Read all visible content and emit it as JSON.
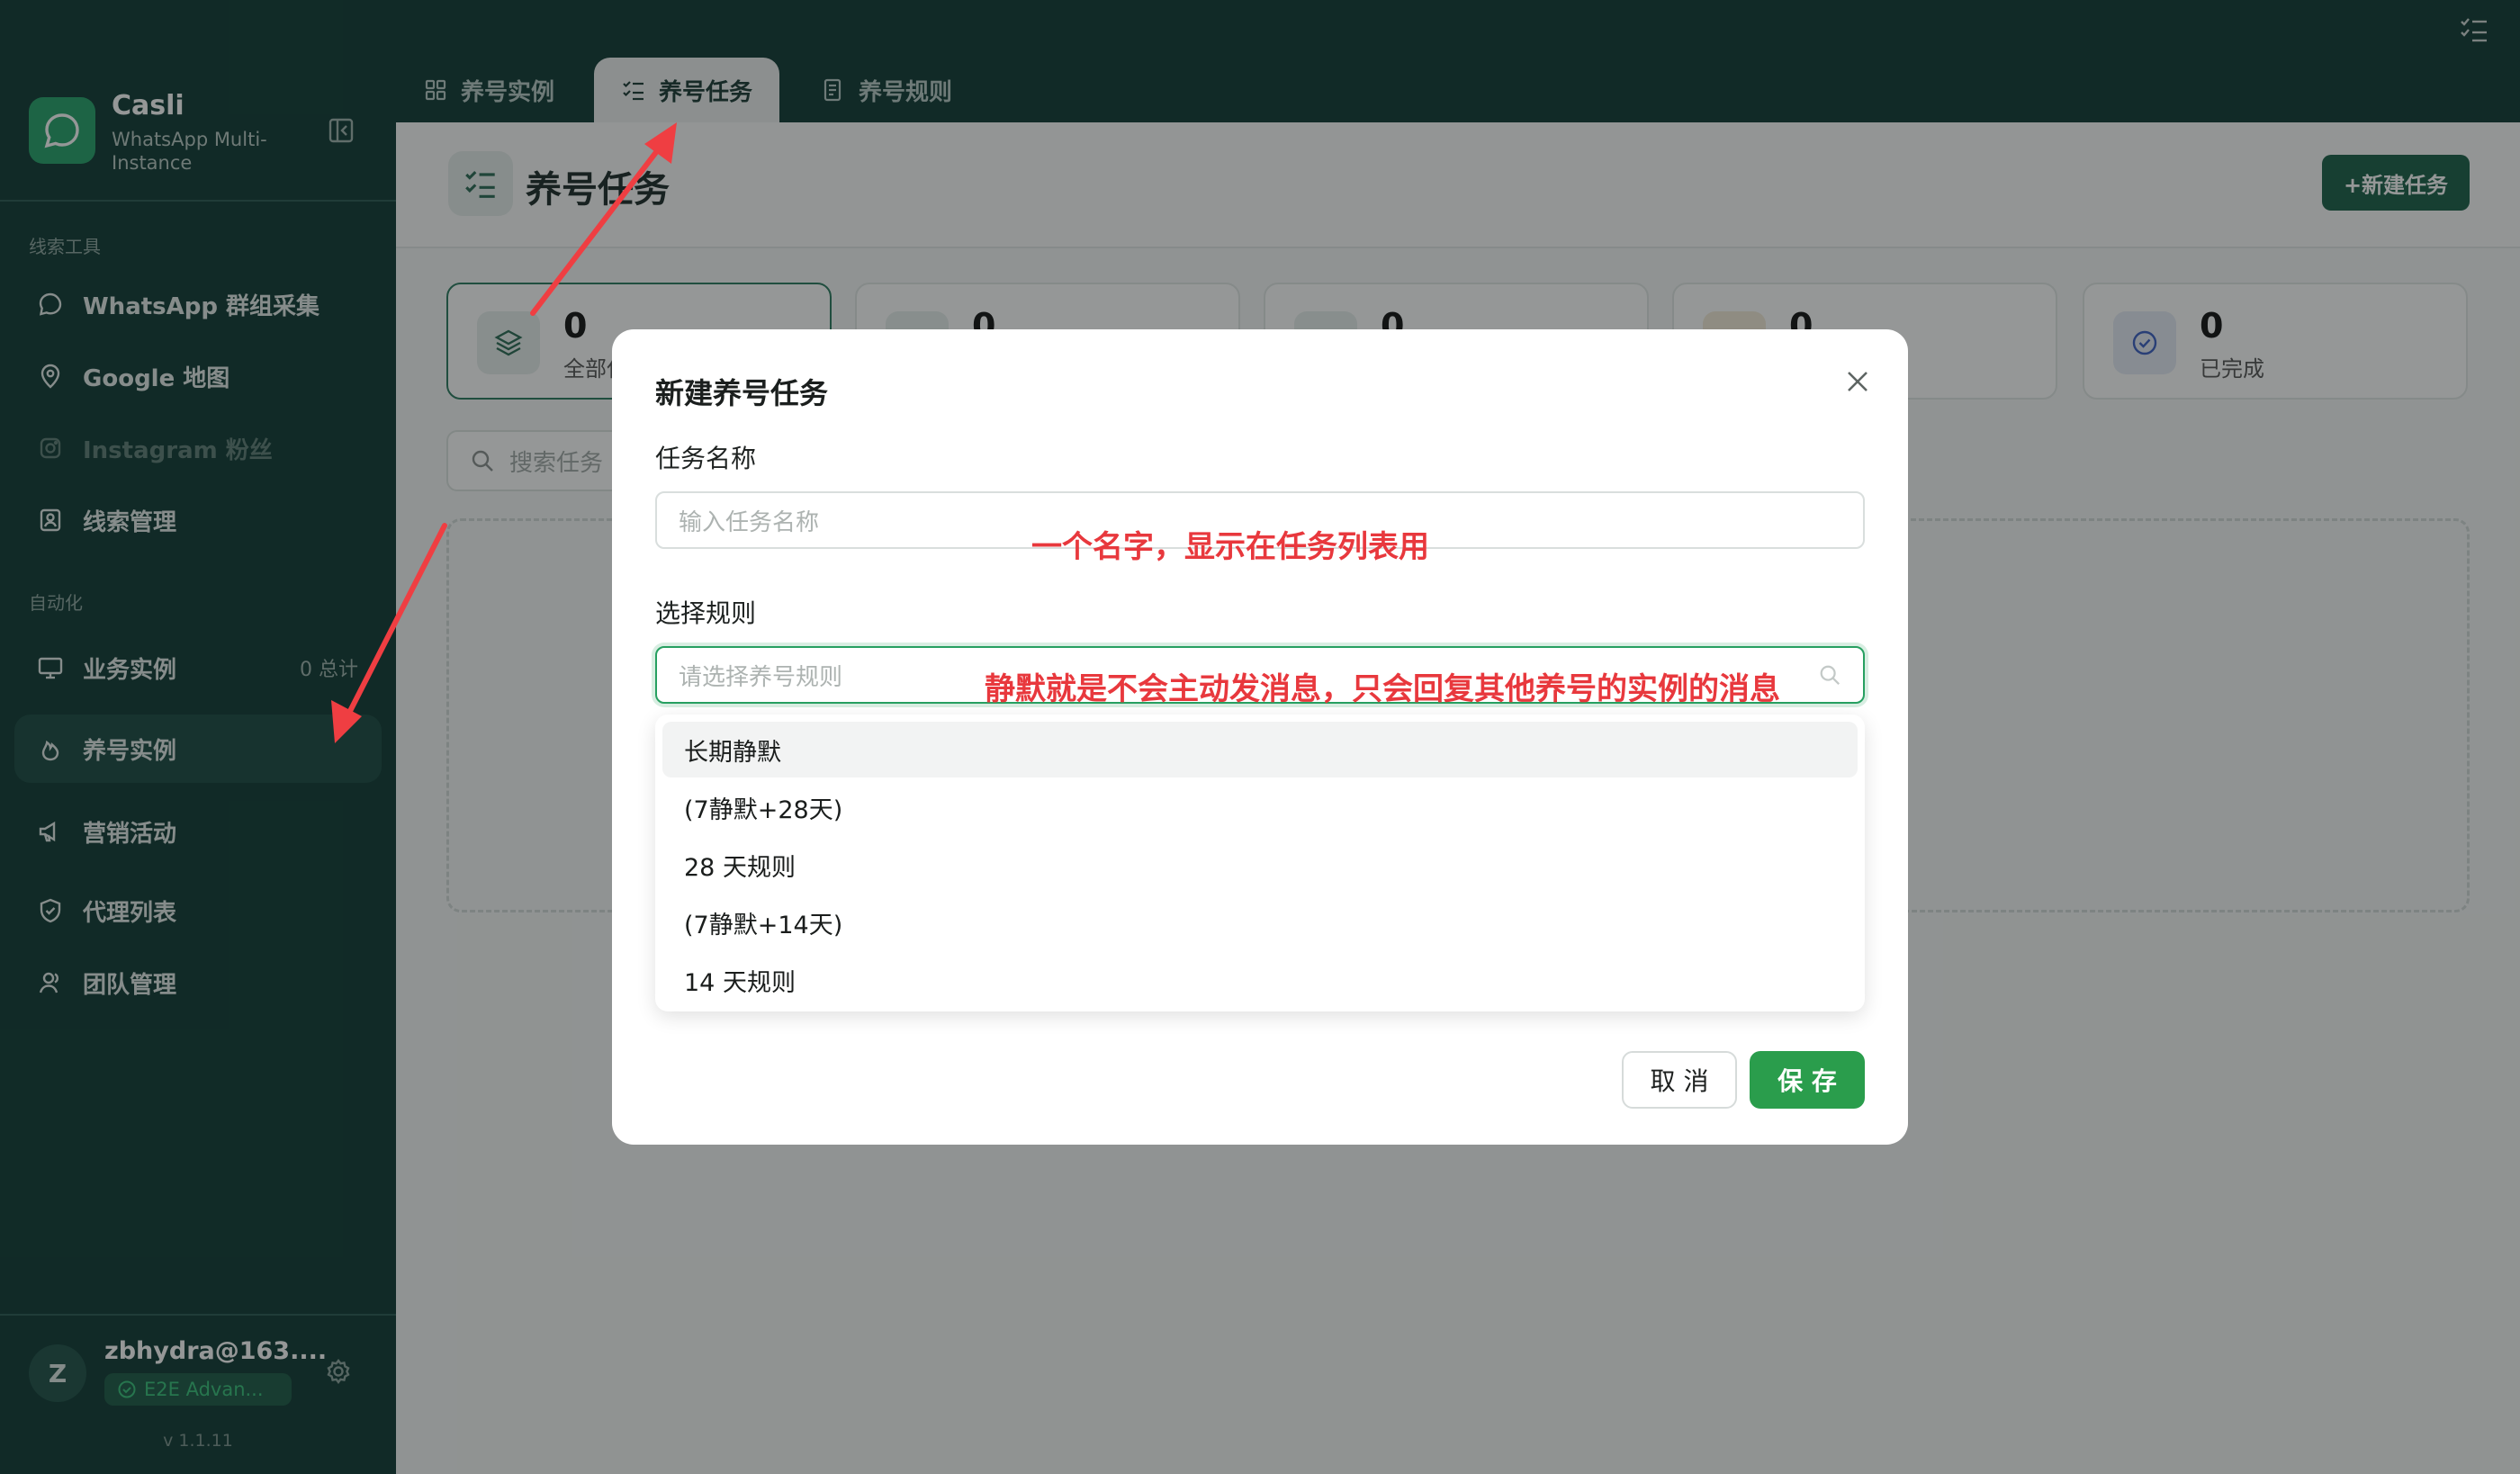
{
  "window": {
    "checklist_icon": "checklist-icon"
  },
  "sidebar": {
    "app_name": "Casli",
    "app_subtitle": "WhatsApp Multi-Instance",
    "section_leads": "线索工具",
    "section_automation": "自动化",
    "items": [
      {
        "label": "WhatsApp 群组采集",
        "icon": "chat-bubble-icon"
      },
      {
        "label": "Google 地图",
        "icon": "map-pin-icon"
      },
      {
        "label": "Instagram 粉丝",
        "icon": "instagram-icon"
      },
      {
        "label": "线索管理",
        "icon": "contact-card-icon"
      },
      {
        "label": "业务实例",
        "icon": "monitor-icon",
        "count": "0 总计"
      },
      {
        "label": "养号实例",
        "icon": "flame-icon"
      },
      {
        "label": "营销活动",
        "icon": "megaphone-icon"
      },
      {
        "label": "代理列表",
        "icon": "shield-icon"
      },
      {
        "label": "团队管理",
        "icon": "user-icon"
      }
    ],
    "user": {
      "avatar_letter": "Z",
      "email": "zbhydra@163....",
      "plan": "E2E Advan..."
    },
    "version": "v 1.1.11"
  },
  "tabs": [
    {
      "label": "养号实例",
      "icon": "grid-icon"
    },
    {
      "label": "养号任务",
      "icon": "task-list-icon",
      "active": true
    },
    {
      "label": "养号规则",
      "icon": "rules-icon"
    }
  ],
  "page": {
    "title": "养号任务",
    "new_task_label": "+新建任务",
    "stats": [
      {
        "value": "0",
        "label": "全部任务"
      },
      {
        "value": "0",
        "label": ""
      },
      {
        "value": "0",
        "label": ""
      },
      {
        "value": "0",
        "label": ""
      },
      {
        "value": "0",
        "label": "已完成"
      }
    ],
    "search_placeholder": "搜索任务"
  },
  "modal": {
    "title": "新建养号任务",
    "name_label": "任务名称",
    "name_placeholder": "输入任务名称",
    "rule_label": "选择规则",
    "rule_placeholder": "请选择养号规则",
    "rule_options": [
      "长期静默",
      "(7静默+28天)",
      "28 天规则",
      "(7静默+14天)",
      "14 天规则"
    ],
    "cancel_label": "取 消",
    "save_label": "保 存"
  },
  "annotations": {
    "name_note": "一个名字，显示在任务列表用",
    "rule_note": "静默就是不会主动发消息，只会回复其他养号的实例的消息"
  },
  "colors": {
    "sidebar_bg": "#0f3a33",
    "accent_green": "#2a9d4c",
    "annotation_red": "#e8383d"
  }
}
